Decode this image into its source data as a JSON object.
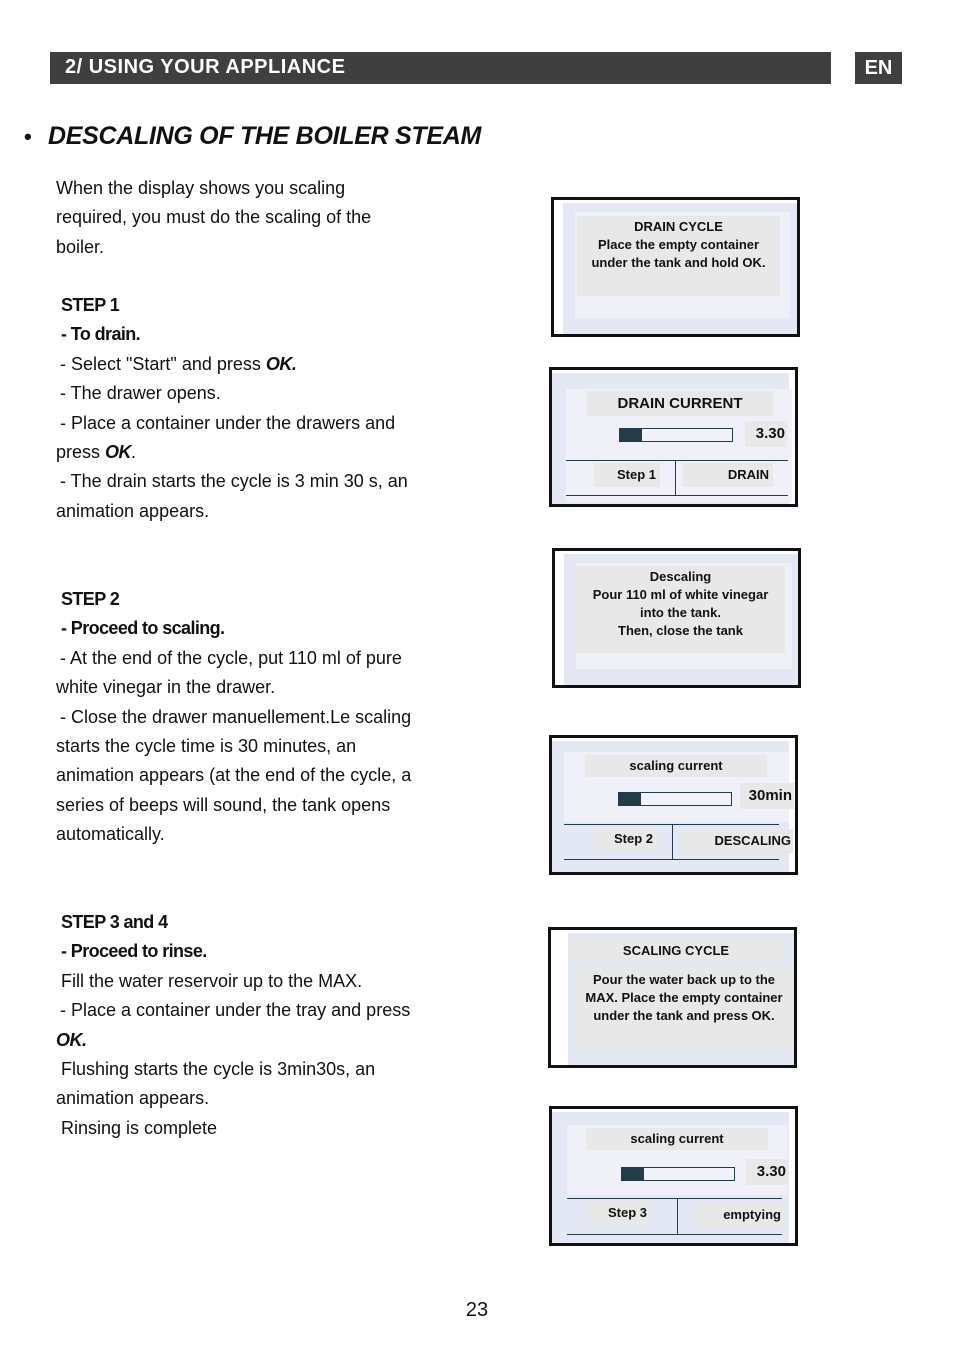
{
  "header": {
    "title": "2/ USING YOUR APPLIANCE",
    "lang": "EN"
  },
  "section": {
    "bullet": "•",
    "title": "DESCALING OF THE BOILER STEAM"
  },
  "intro": [
    "When the display shows you scaling",
    "required, you must do the scaling of the",
    "boiler."
  ],
  "step1": {
    "heading": "STEP 1",
    "subheading": "- To drain.",
    "line1_pre": "- Select \"Start\" and press ",
    "line1_ok": "OK.",
    "line2": "- The drawer opens.",
    "line3": "- Place a container under the drawers and",
    "line4_pre": "press ",
    "line4_ok": "OK",
    "line4_post": ".",
    "line5": "- The drain starts the cycle is 3 min 30 s, an",
    "line6": "animation appears."
  },
  "step2": {
    "heading": "STEP 2",
    "subheading": "- Proceed to scaling.",
    "lines": [
      "- At the end of the cycle, put 110 ml of pure",
      "white vinegar in the drawer.",
      "- Close the drawer manuellement.Le scaling",
      "starts the cycle time is 30 minutes, an",
      "animation appears (at the end of the cycle, a",
      "series of beeps will sound, the tank opens",
      "automatically."
    ]
  },
  "step34": {
    "heading": "STEP 3 and 4",
    "subheading": "- Proceed to rinse.",
    "line1": "Fill the water reservoir up to the MAX.",
    "line2": "- Place a container under the tray and press",
    "line3_ok": "OK.",
    "line4": "Flushing starts the cycle is 3min30s, an",
    "line5": "animation appears.",
    "line6": "Rinsing is complete"
  },
  "screens": {
    "drain_cycle": {
      "lines": [
        "DRAIN CYCLE",
        "Place the empty container",
        "under the tank and hold OK."
      ]
    },
    "drain_current": {
      "title": "DRAIN CURRENT",
      "value": "3.30",
      "progress": 0.2,
      "step": "Step 1",
      "mode": "DRAIN"
    },
    "descaling": {
      "lines": [
        "Descaling",
        "Pour 110 ml of white vinegar",
        "into the tank.",
        "Then, close the tank"
      ]
    },
    "scaling_current_2": {
      "title": "scaling current",
      "value": "30min",
      "progress": 0.2,
      "step": "Step 2",
      "mode": "DESCALING"
    },
    "scaling_cycle": {
      "title": "SCALING CYCLE",
      "lines": [
        "Pour the water back up to the",
        "MAX. Place the empty container",
        "under the tank and press OK."
      ]
    },
    "scaling_current_3": {
      "title": "scaling current",
      "value": "3.30",
      "progress": 0.2,
      "step": "Step 3",
      "mode": "emptying"
    }
  },
  "page_number": "23"
}
